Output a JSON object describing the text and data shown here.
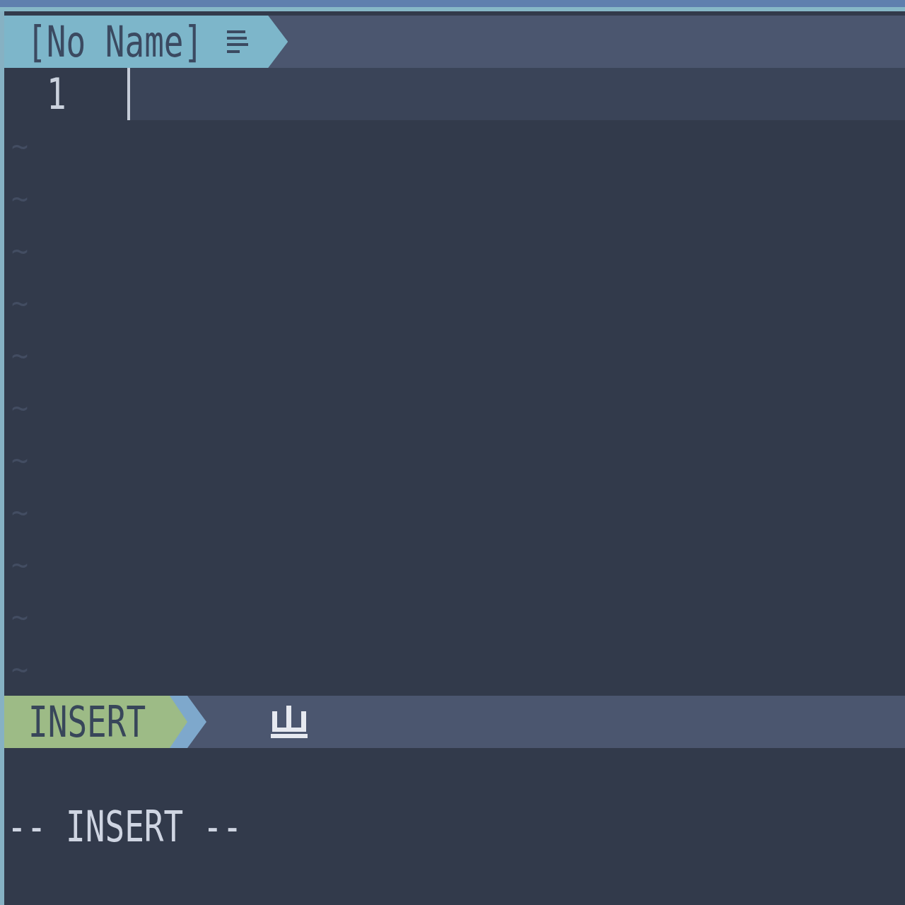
{
  "tabline": {
    "tabs": [
      {
        "label": "[No Name]",
        "selected": true
      }
    ]
  },
  "buffer": {
    "lines": [
      {
        "number": "1",
        "current": true
      }
    ],
    "filler_lines": [
      "~",
      "~",
      "~",
      "~",
      "~",
      "~",
      "~",
      "~",
      "~",
      "~",
      "~"
    ]
  },
  "statusline": {
    "mode": {
      "label": "INSERT",
      "kind": "insert"
    }
  },
  "cmdline": {
    "message": "-- INSERT --"
  }
}
